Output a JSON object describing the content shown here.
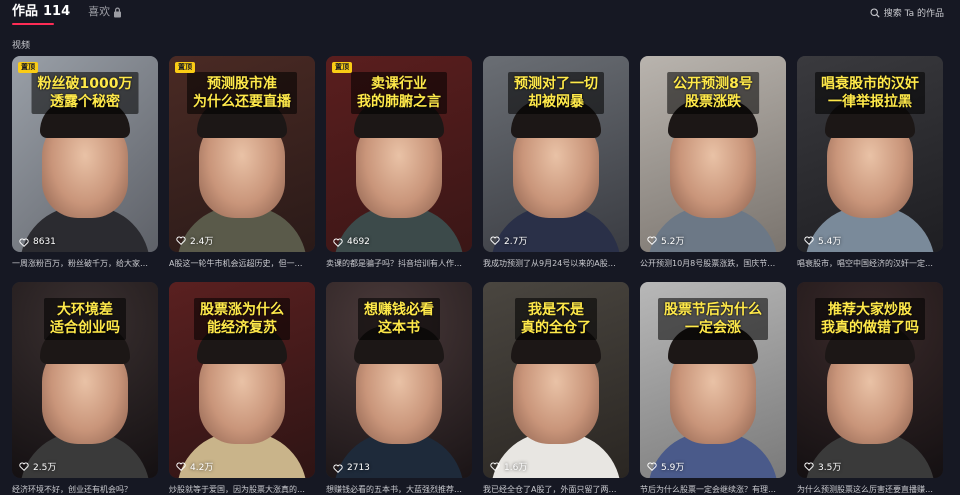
{
  "tabs": {
    "works_label": "作品",
    "works_count": "114",
    "likes_label": "喜欢"
  },
  "search": {
    "label": "搜索 Ta 的作品"
  },
  "section_title": "视频",
  "pin_label": "置顶",
  "colors": {
    "accent": "#fe2c55",
    "background": "#161823",
    "caption": "#ffe94a",
    "pin": "#facc15"
  },
  "videos": [
    {
      "caption": [
        "粉丝破1000万",
        "透露个秘密"
      ],
      "likes": "8631",
      "desc": "一周涨粉百万，粉丝破千万，给大家…",
      "pinned": true,
      "bg": "linear-gradient(135deg,#9aa0a8,#5e6168)",
      "shirt": "#2b2b30"
    },
    {
      "caption": [
        "预测股市准",
        "为什么还要直播"
      ],
      "likes": "2.4万",
      "desc": "A股这一轮牛市机会远超历史，但一…",
      "pinned": true,
      "bg": "linear-gradient(160deg,#4a2a24,#2a1a18)",
      "shirt": "#5a5a4a"
    },
    {
      "caption": [
        "卖课行业",
        "我的肺腑之言"
      ],
      "likes": "4692",
      "desc": "卖课的都是骗子吗？抖音培训有人作…",
      "pinned": true,
      "bg": "linear-gradient(160deg,#5a1e1e,#3a1616)",
      "shirt": "#3c4a4a"
    },
    {
      "caption": [
        "预测对了一切",
        "却被网暴"
      ],
      "likes": "2.7万",
      "desc": "我成功预测了从9月24号以来的A股…",
      "pinned": false,
      "bg": "linear-gradient(160deg,#6a6e74,#3a3c42)",
      "shirt": "#2a3048"
    },
    {
      "caption": [
        "公开预测8号",
        "股票涨跌"
      ],
      "likes": "5.2万",
      "desc": "公开预测10月8号股票涨跌，国庆节…",
      "pinned": false,
      "bg": "linear-gradient(160deg,#b9b4ae,#7a746e)",
      "shirt": "#6c7886"
    },
    {
      "caption": [
        "唱衰股市的汉奸",
        "一律举报拉黑"
      ],
      "likes": "5.4万",
      "desc": "唱衰股市，唱空中国经济的汉奸一定…",
      "pinned": false,
      "bg": "linear-gradient(160deg,#3a3a3e,#1e1e22)",
      "shirt": "#7a8a9a"
    },
    {
      "caption": [
        "大环境差",
        "适合创业吗"
      ],
      "likes": "2.5万",
      "desc": "经济环境不好，创业还有机会吗？",
      "pinned": false,
      "bg": "radial-gradient(circle at 50% 20%,#3a3030,#141012)",
      "shirt": "#3a3a3a"
    },
    {
      "caption": [
        "股票涨为什么",
        "能经济复苏"
      ],
      "likes": "4.2万",
      "desc": "炒股就等于爱国，因为股票大涨真的…",
      "pinned": false,
      "bg": "linear-gradient(160deg,#5a2020,#2e1414)",
      "shirt": "#c9b48a"
    },
    {
      "caption": [
        "想赚钱必看",
        "这本书"
      ],
      "likes": "2713",
      "desc": "想赚钱必看的五本书，大蓝强烈推荐…",
      "pinned": false,
      "bg": "radial-gradient(circle at 40% 20%,#4a3a3a,#1a1416)",
      "shirt": "#1e2a3a"
    },
    {
      "caption": [
        "我是不是",
        "真的全仓了"
      ],
      "likes": "1.6万",
      "desc": "我已经全仓了A股了，外面只留了两…",
      "pinned": false,
      "bg": "linear-gradient(160deg,#4a4640,#2a2622)",
      "shirt": "#e8e6e2"
    },
    {
      "caption": [
        "股票节后为什么",
        "一定会涨"
      ],
      "likes": "5.9万",
      "desc": "节后为什么股票一定会继续涨？有理…",
      "pinned": false,
      "bg": "linear-gradient(160deg,#b8b8b8,#7a7a7a)",
      "shirt": "#4a5a8a"
    },
    {
      "caption": [
        "推荐大家炒股",
        "我真的做错了吗"
      ],
      "likes": "3.5万",
      "desc": "为什么预测股票这么厉害还要直播赚…",
      "pinned": false,
      "bg": "radial-gradient(circle at 50% 20%,#3a2a2a,#141012)",
      "shirt": "#3a3a3a"
    }
  ]
}
